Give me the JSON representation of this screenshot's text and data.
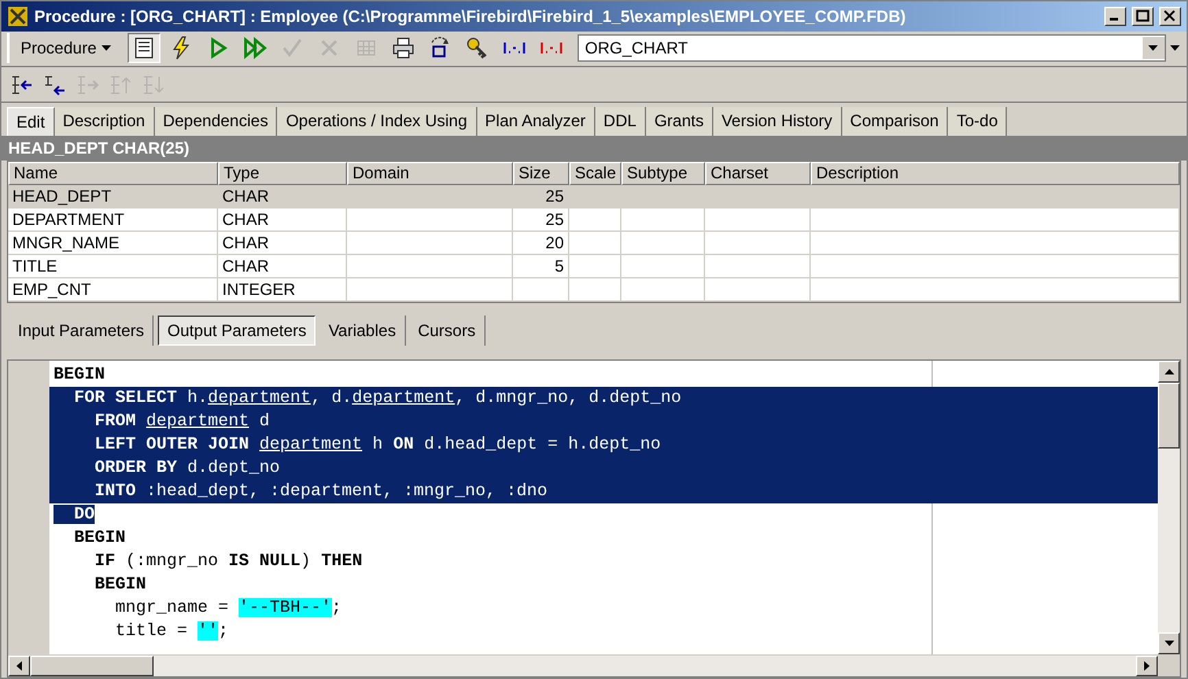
{
  "window": {
    "title": "Procedure : [ORG_CHART] : Employee (C:\\Programme\\Firebird\\Firebird_1_5\\examples\\EMPLOYEE_COMP.FDB)"
  },
  "toolbar": {
    "menu_label": "Procedure",
    "object_name": "ORG_CHART",
    "tools": [
      {
        "kind": "form",
        "disabled": false,
        "selected": true
      },
      {
        "kind": "lightning",
        "disabled": false,
        "selected": false
      },
      {
        "kind": "run",
        "disabled": false,
        "selected": false
      },
      {
        "kind": "run-all",
        "disabled": false,
        "selected": false
      },
      {
        "kind": "check",
        "disabled": true,
        "selected": false
      },
      {
        "kind": "cross",
        "disabled": true,
        "selected": false
      },
      {
        "kind": "grid",
        "disabled": true,
        "selected": false
      },
      {
        "kind": "printer",
        "disabled": false,
        "selected": false
      },
      {
        "kind": "refresh",
        "disabled": false,
        "selected": false
      },
      {
        "kind": "keys",
        "disabled": false,
        "selected": false
      },
      {
        "kind": "params-blue",
        "disabled": false,
        "selected": false
      },
      {
        "kind": "params-red",
        "disabled": false,
        "selected": false
      }
    ]
  },
  "toolbar2": [
    {
      "kind": "add-param",
      "disabled": false
    },
    {
      "kind": "insert-param",
      "disabled": false
    },
    {
      "kind": "remove-param",
      "disabled": true
    },
    {
      "kind": "move-up",
      "disabled": true
    },
    {
      "kind": "move-down",
      "disabled": true
    }
  ],
  "tabs": [
    {
      "label": "Edit",
      "selected": true
    },
    {
      "label": "Description",
      "selected": false
    },
    {
      "label": "Dependencies",
      "selected": false
    },
    {
      "label": "Operations / Index Using",
      "selected": false
    },
    {
      "label": "Plan Analyzer",
      "selected": false
    },
    {
      "label": "DDL",
      "selected": false
    },
    {
      "label": "Grants",
      "selected": false
    },
    {
      "label": "Version History",
      "selected": false
    },
    {
      "label": "Comparison",
      "selected": false
    },
    {
      "label": "To-do",
      "selected": false
    }
  ],
  "field_header": "HEAD_DEPT CHAR(25)",
  "table": {
    "columns": [
      "Name",
      "Type",
      "Domain",
      "Size",
      "Scale",
      "Subtype",
      "Charset",
      "Description"
    ],
    "rows": [
      {
        "cells": [
          "HEAD_DEPT",
          "CHAR",
          "",
          "25",
          "",
          "",
          "",
          ""
        ],
        "selected": true
      },
      {
        "cells": [
          "DEPARTMENT",
          "CHAR",
          "",
          "25",
          "",
          "",
          "",
          ""
        ],
        "selected": false
      },
      {
        "cells": [
          "MNGR_NAME",
          "CHAR",
          "",
          "20",
          "",
          "",
          "",
          ""
        ],
        "selected": false
      },
      {
        "cells": [
          "TITLE",
          "CHAR",
          "",
          "5",
          "",
          "",
          "",
          ""
        ],
        "selected": false
      },
      {
        "cells": [
          "EMP_CNT",
          "INTEGER",
          "",
          "",
          "",
          "",
          "",
          ""
        ],
        "selected": false
      }
    ]
  },
  "param_tabs": [
    {
      "label": "Input Parameters",
      "selected": false
    },
    {
      "label": "Output Parameters",
      "selected": true
    },
    {
      "label": "Variables",
      "selected": false
    },
    {
      "label": "Cursors",
      "selected": false
    }
  ],
  "code_lines": [
    {
      "selected": false,
      "segments": [
        {
          "kind": "keyword",
          "text": "BEGIN"
        }
      ]
    },
    {
      "selected": true,
      "partial": false,
      "segments": [
        {
          "kind": "keyword",
          "text": "  FOR SELECT "
        },
        {
          "kind": "plain",
          "text": "h."
        },
        {
          "kind": "link",
          "text": "department"
        },
        {
          "kind": "plain",
          "text": ", d."
        },
        {
          "kind": "link",
          "text": "department"
        },
        {
          "kind": "plain",
          "text": ", d.mngr_no, d.dept_no"
        }
      ]
    },
    {
      "selected": true,
      "partial": false,
      "segments": [
        {
          "kind": "keyword",
          "text": "    FROM "
        },
        {
          "kind": "link",
          "text": "department"
        },
        {
          "kind": "plain",
          "text": " d"
        }
      ]
    },
    {
      "selected": true,
      "partial": false,
      "segments": [
        {
          "kind": "keyword",
          "text": "    LEFT OUTER JOIN "
        },
        {
          "kind": "link",
          "text": "department"
        },
        {
          "kind": "plain",
          "text": " h "
        },
        {
          "kind": "keyword",
          "text": "ON"
        },
        {
          "kind": "plain",
          "text": " d.head_dept = h.dept_no"
        }
      ]
    },
    {
      "selected": true,
      "partial": false,
      "segments": [
        {
          "kind": "keyword",
          "text": "    ORDER BY "
        },
        {
          "kind": "plain",
          "text": "d.dept_no"
        }
      ]
    },
    {
      "selected": true,
      "partial": false,
      "segments": [
        {
          "kind": "keyword",
          "text": "    INTO "
        },
        {
          "kind": "plain",
          "text": ":head_dept, :department, :mngr_no, :dno"
        }
      ]
    },
    {
      "selected": true,
      "partial": true,
      "segments": [
        {
          "kind": "keyword",
          "text": "  DO"
        }
      ]
    },
    {
      "selected": false,
      "segments": [
        {
          "kind": "keyword",
          "text": "  BEGIN"
        }
      ]
    },
    {
      "selected": false,
      "segments": [
        {
          "kind": "keyword",
          "text": "    IF "
        },
        {
          "kind": "plain",
          "text": "(:mngr_no "
        },
        {
          "kind": "keyword",
          "text": "IS NULL"
        },
        {
          "kind": "plain",
          "text": ") "
        },
        {
          "kind": "keyword",
          "text": "THEN"
        }
      ]
    },
    {
      "selected": false,
      "segments": [
        {
          "kind": "keyword",
          "text": "    BEGIN"
        }
      ]
    },
    {
      "selected": false,
      "segments": [
        {
          "kind": "plain",
          "text": "      mngr_name = "
        },
        {
          "kind": "string",
          "text": "'--TBH--'"
        },
        {
          "kind": "plain",
          "text": ";"
        }
      ]
    },
    {
      "selected": false,
      "segments": [
        {
          "kind": "plain",
          "text": "      title = "
        },
        {
          "kind": "string",
          "text": "''"
        },
        {
          "kind": "plain",
          "text": ";"
        }
      ]
    }
  ]
}
